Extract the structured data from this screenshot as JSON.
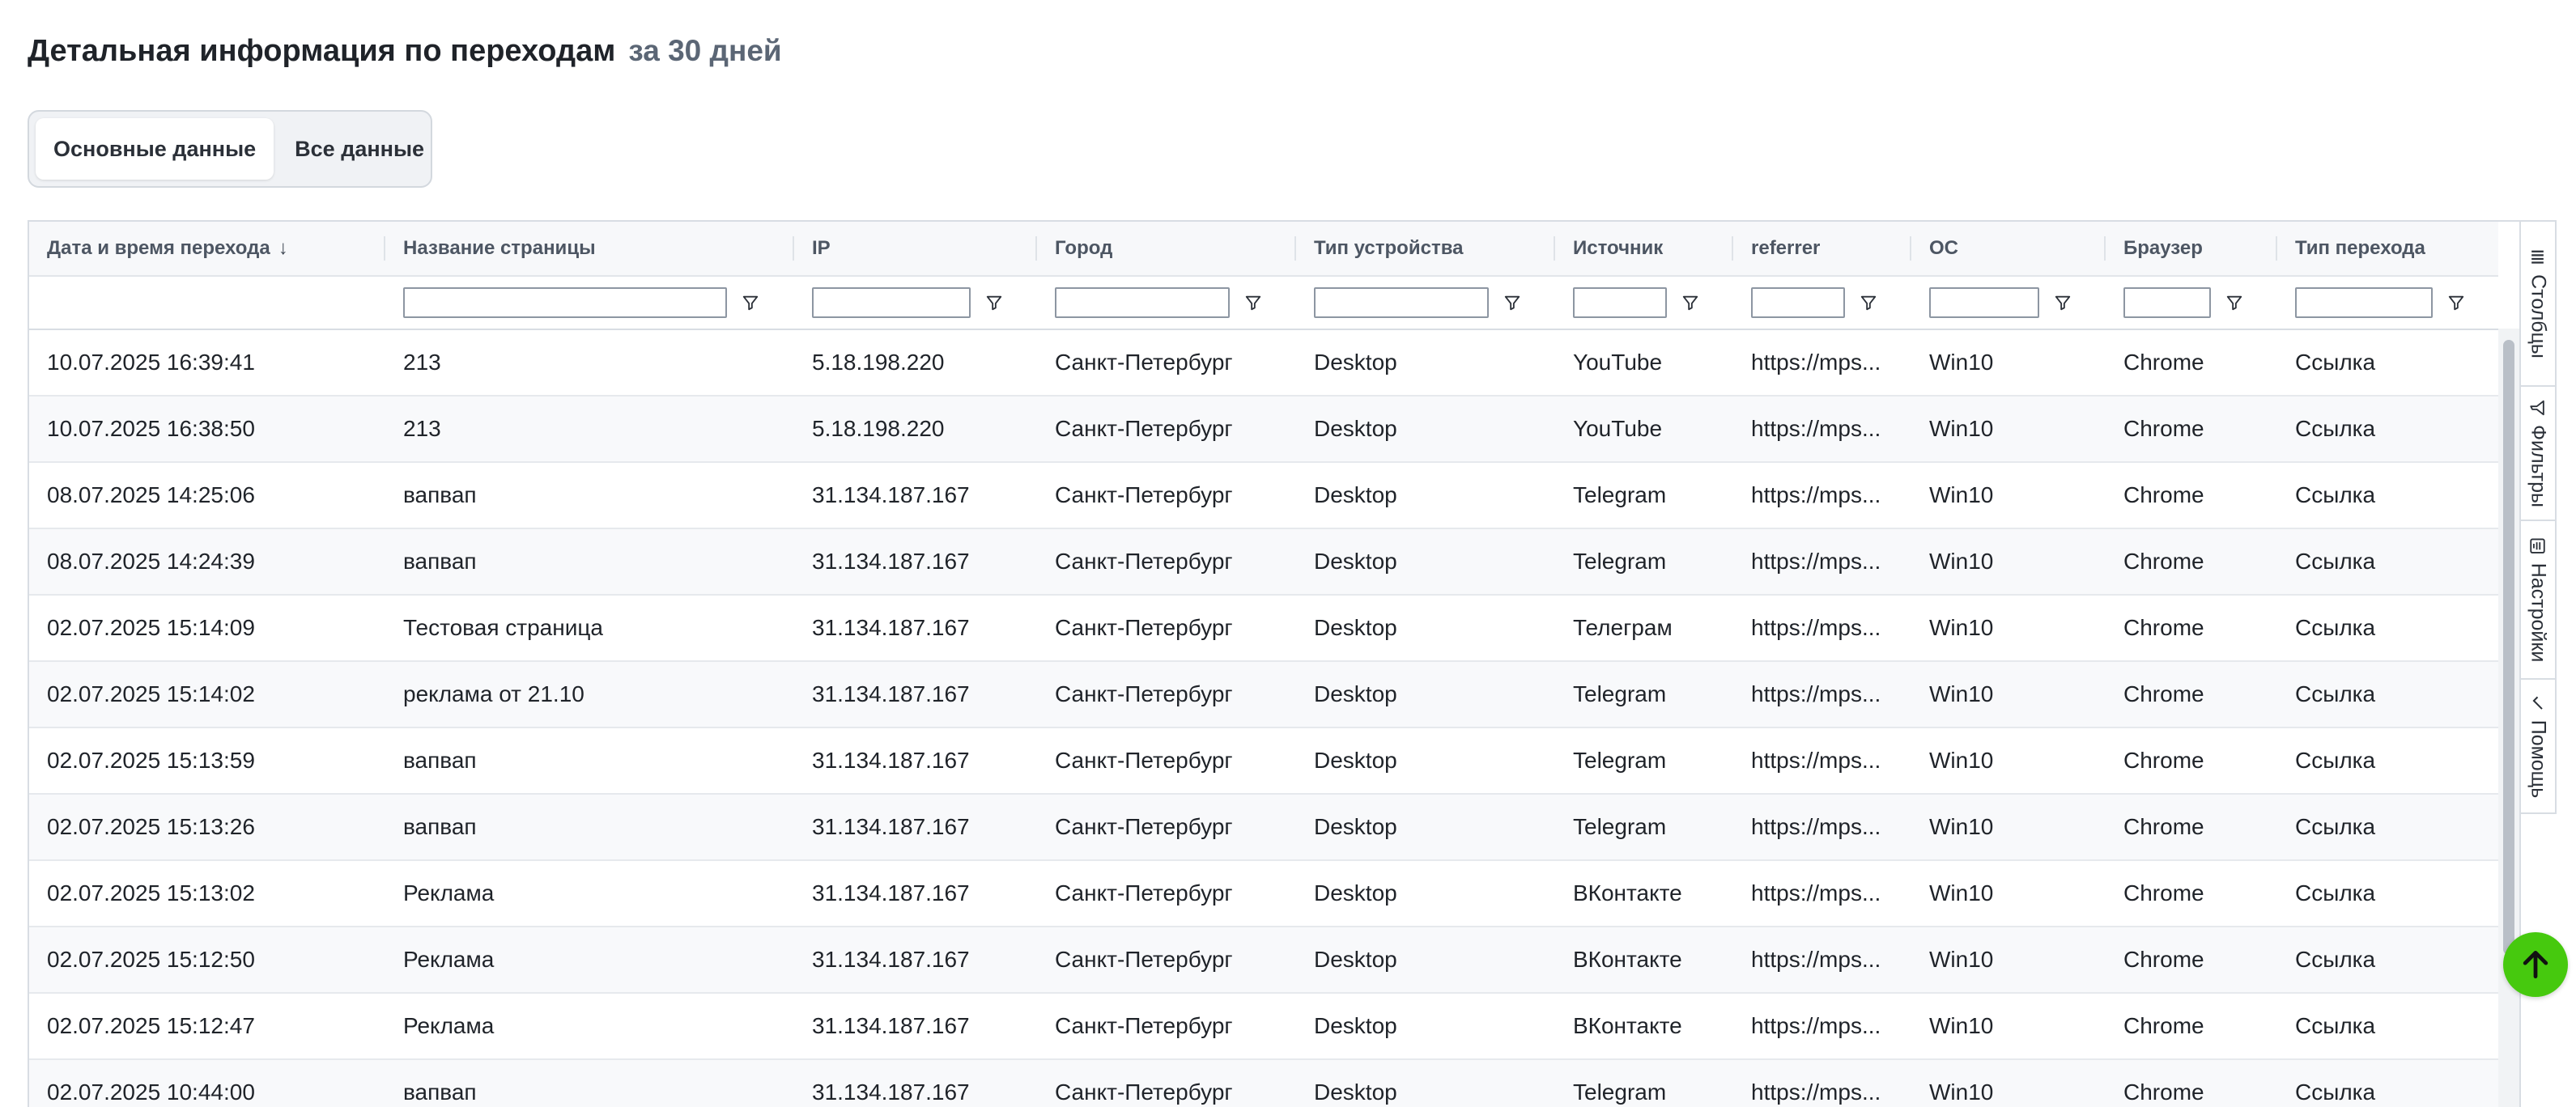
{
  "heading": {
    "title": "Детальная информация по переходам",
    "period": "за 30 дней"
  },
  "tabs": [
    {
      "label": "Основные данные",
      "active": true
    },
    {
      "label": "Все данные",
      "active": false
    }
  ],
  "columns": [
    {
      "label": "Дата и время перехода",
      "sort": "desc",
      "filterable": false
    },
    {
      "label": "Название страницы",
      "filterable": true
    },
    {
      "label": "IP",
      "filterable": true
    },
    {
      "label": "Город",
      "filterable": true
    },
    {
      "label": "Тип устройства",
      "filterable": true
    },
    {
      "label": "Источник",
      "filterable": true
    },
    {
      "label": "referrer",
      "filterable": true
    },
    {
      "label": "ОС",
      "filterable": true
    },
    {
      "label": "Браузер",
      "filterable": true
    },
    {
      "label": "Тип перехода",
      "filterable": true
    }
  ],
  "rows": [
    [
      "10.07.2025 16:39:41",
      "213",
      "5.18.198.220",
      "Санкт-Петербург",
      "Desktop",
      "YouTube",
      "https://mps...",
      "Win10",
      "Chrome",
      "Ссылка"
    ],
    [
      "10.07.2025 16:38:50",
      "213",
      "5.18.198.220",
      "Санкт-Петербург",
      "Desktop",
      "YouTube",
      "https://mps...",
      "Win10",
      "Chrome",
      "Ссылка"
    ],
    [
      "08.07.2025 14:25:06",
      "вапвап",
      "31.134.187.167",
      "Санкт-Петербург",
      "Desktop",
      "Telegram",
      "https://mps...",
      "Win10",
      "Chrome",
      "Ссылка"
    ],
    [
      "08.07.2025 14:24:39",
      "вапвап",
      "31.134.187.167",
      "Санкт-Петербург",
      "Desktop",
      "Telegram",
      "https://mps...",
      "Win10",
      "Chrome",
      "Ссылка"
    ],
    [
      "02.07.2025 15:14:09",
      "Тестовая страница",
      "31.134.187.167",
      "Санкт-Петербург",
      "Desktop",
      "Телеграм",
      "https://mps...",
      "Win10",
      "Chrome",
      "Ссылка"
    ],
    [
      "02.07.2025 15:14:02",
      "реклама от 21.10",
      "31.134.187.167",
      "Санкт-Петербург",
      "Desktop",
      "Telegram",
      "https://mps...",
      "Win10",
      "Chrome",
      "Ссылка"
    ],
    [
      "02.07.2025 15:13:59",
      "вапвап",
      "31.134.187.167",
      "Санкт-Петербург",
      "Desktop",
      "Telegram",
      "https://mps...",
      "Win10",
      "Chrome",
      "Ссылка"
    ],
    [
      "02.07.2025 15:13:26",
      "вапвап",
      "31.134.187.167",
      "Санкт-Петербург",
      "Desktop",
      "Telegram",
      "https://mps...",
      "Win10",
      "Chrome",
      "Ссылка"
    ],
    [
      "02.07.2025 15:13:02",
      "Реклама",
      "31.134.187.167",
      "Санкт-Петербург",
      "Desktop",
      "ВКонтакте",
      "https://mps...",
      "Win10",
      "Chrome",
      "Ссылка"
    ],
    [
      "02.07.2025 15:12:50",
      "Реклама",
      "31.134.187.167",
      "Санкт-Петербург",
      "Desktop",
      "ВКонтакте",
      "https://mps...",
      "Win10",
      "Chrome",
      "Ссылка"
    ],
    [
      "02.07.2025 15:12:47",
      "Реклама",
      "31.134.187.167",
      "Санкт-Петербург",
      "Desktop",
      "ВКонтакте",
      "https://mps...",
      "Win10",
      "Chrome",
      "Ссылка"
    ],
    [
      "02.07.2025 10:44:00",
      "вапвап",
      "31.134.187.167",
      "Санкт-Петербург",
      "Desktop",
      "Telegram",
      "https://mps...",
      "Win10",
      "Chrome",
      "Ссылка"
    ]
  ],
  "side_panel": [
    {
      "label": "Столбцы",
      "icon": "columns-icon"
    },
    {
      "label": "Фильтры",
      "icon": "filter-icon"
    },
    {
      "label": "Настройки",
      "icon": "settings-icon"
    },
    {
      "label": "Помощь",
      "icon": "check-icon"
    }
  ],
  "scroll_top_icon": "arrow-up-icon",
  "colors": {
    "accent_green": "#46c90e",
    "header_bg": "#f7f8fa",
    "border": "#d8dde3",
    "text": "#1f2329",
    "muted": "#5b6675"
  }
}
